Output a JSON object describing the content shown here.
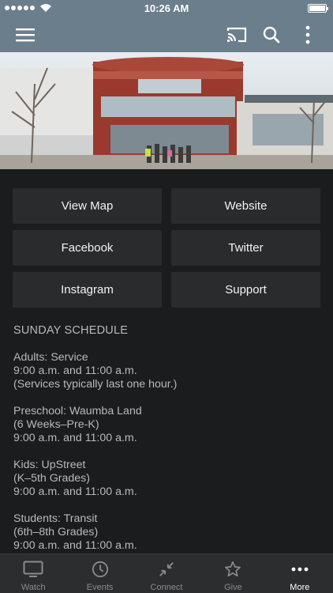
{
  "status_bar": {
    "time": "10:26 AM"
  },
  "colors": {
    "header_bg": "#6b7e8c",
    "page_bg": "#1b1c1e",
    "button_bg": "#2a2b2d",
    "tab_bar_bg": "#2c2d2f"
  },
  "app_bar": {
    "icons": [
      "menu-icon",
      "cast-icon",
      "search-icon",
      "more-vert-icon"
    ]
  },
  "buttons": [
    {
      "label": "View Map"
    },
    {
      "label": "Website"
    },
    {
      "label": "Facebook"
    },
    {
      "label": "Twitter"
    },
    {
      "label": "Instagram"
    },
    {
      "label": "Support"
    }
  ],
  "schedule": {
    "heading": "SUNDAY SCHEDULE",
    "blocks": [
      {
        "lines": [
          "Adults: Service",
          "9:00 a.m. and 11:00 a.m.",
          "(Services typically last one hour.)"
        ]
      },
      {
        "lines": [
          "Preschool: Waumba Land",
          "(6 Weeks–Pre-K)",
          "9:00 a.m. and 11:00 a.m."
        ]
      },
      {
        "lines": [
          "Kids: UpStreet",
          "(K–5th Grades)",
          "9:00 a.m. and 11:00 a.m."
        ]
      },
      {
        "lines": [
          "Students: Transit",
          "(6th–8th Grades)",
          "9:00 a.m. and 11:00 a.m."
        ]
      }
    ]
  },
  "tab_bar": {
    "active": "More",
    "tabs": [
      {
        "label": "Watch",
        "icon": "tv-icon"
      },
      {
        "label": "Events",
        "icon": "clock-icon"
      },
      {
        "label": "Connect",
        "icon": "arrows-in-icon"
      },
      {
        "label": "Give",
        "icon": "star-icon"
      },
      {
        "label": "More",
        "icon": "more-horiz-icon"
      }
    ]
  }
}
